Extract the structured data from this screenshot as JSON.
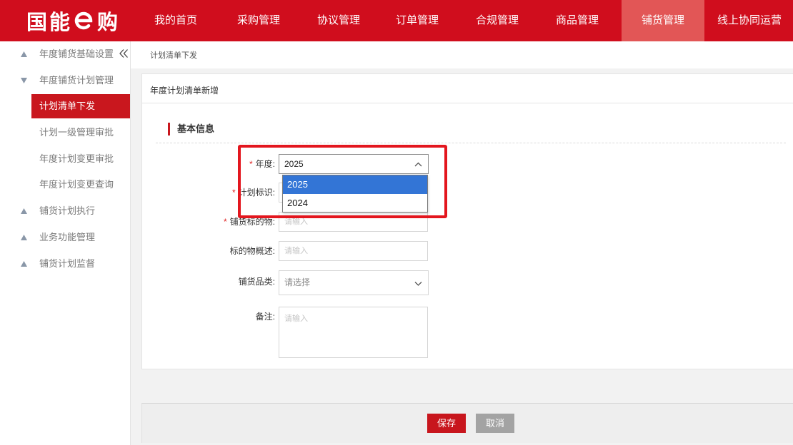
{
  "logo": {
    "part1": "国能",
    "part2": "购",
    "mark_icon": "e-logo-icon"
  },
  "top_nav": {
    "active_index": 6,
    "items": [
      {
        "label": "我的首页"
      },
      {
        "label": "采购管理"
      },
      {
        "label": "协议管理"
      },
      {
        "label": "订单管理"
      },
      {
        "label": "合规管理"
      },
      {
        "label": "商品管理"
      },
      {
        "label": "铺货管理"
      },
      {
        "label": "线上协同运营"
      }
    ]
  },
  "sidebar": {
    "collapse_icon": "double-chevron-left-icon",
    "items": [
      {
        "label": "年度铺货基础设置",
        "level": 1,
        "expanded": false,
        "icon": "triangle-up-icon"
      },
      {
        "label": "年度铺货计划管理",
        "level": 1,
        "expanded": true,
        "icon": "triangle-down-icon"
      },
      {
        "label": "计划清单下发",
        "level": 2,
        "active": true
      },
      {
        "label": "计划一级管理审批",
        "level": 2
      },
      {
        "label": "年度计划变更审批",
        "level": 2
      },
      {
        "label": "年度计划变更查询",
        "level": 2
      },
      {
        "label": "铺货计划执行",
        "level": 1,
        "expanded": false,
        "icon": "triangle-up-icon"
      },
      {
        "label": "业务功能管理",
        "level": 1,
        "expanded": false,
        "icon": "triangle-up-icon"
      },
      {
        "label": "铺货计划监督",
        "level": 1,
        "expanded": false,
        "icon": "triangle-up-icon"
      }
    ]
  },
  "breadcrumb": {
    "current": "计划清单下发"
  },
  "card": {
    "title": "年度计划清单新增"
  },
  "section": {
    "title": "基本信息"
  },
  "form": {
    "required_mark": "*",
    "year": {
      "label": "年度:",
      "required": true,
      "value": "2025",
      "dropdown_open": true,
      "options": [
        "2025",
        "2024"
      ],
      "highlighted_index": 0,
      "icon": "chevron-up-icon"
    },
    "plan_id": {
      "label": "计划标识:",
      "required": true
    },
    "target": {
      "label": "铺货标的物:",
      "required": true,
      "placeholder": "请输入"
    },
    "target_desc": {
      "label": "标的物概述:",
      "required": false,
      "placeholder": "请输入"
    },
    "category": {
      "label": "铺货品类:",
      "required": false,
      "placeholder": "请选择",
      "icon": "chevron-down-icon"
    },
    "remark": {
      "label": "备注:",
      "required": false,
      "placeholder": "请输入"
    }
  },
  "footer": {
    "save_label": "保存",
    "cancel_label": "取消"
  },
  "colors": {
    "header_red": "#d00d1d",
    "nav_active": "#e25656",
    "sidebar_active": "#c9171e",
    "save_button": "#c8161d",
    "cancel_button": "#a3a3a3",
    "option_highlight": "#3375d6",
    "annotation_outline": "#e3161e"
  }
}
